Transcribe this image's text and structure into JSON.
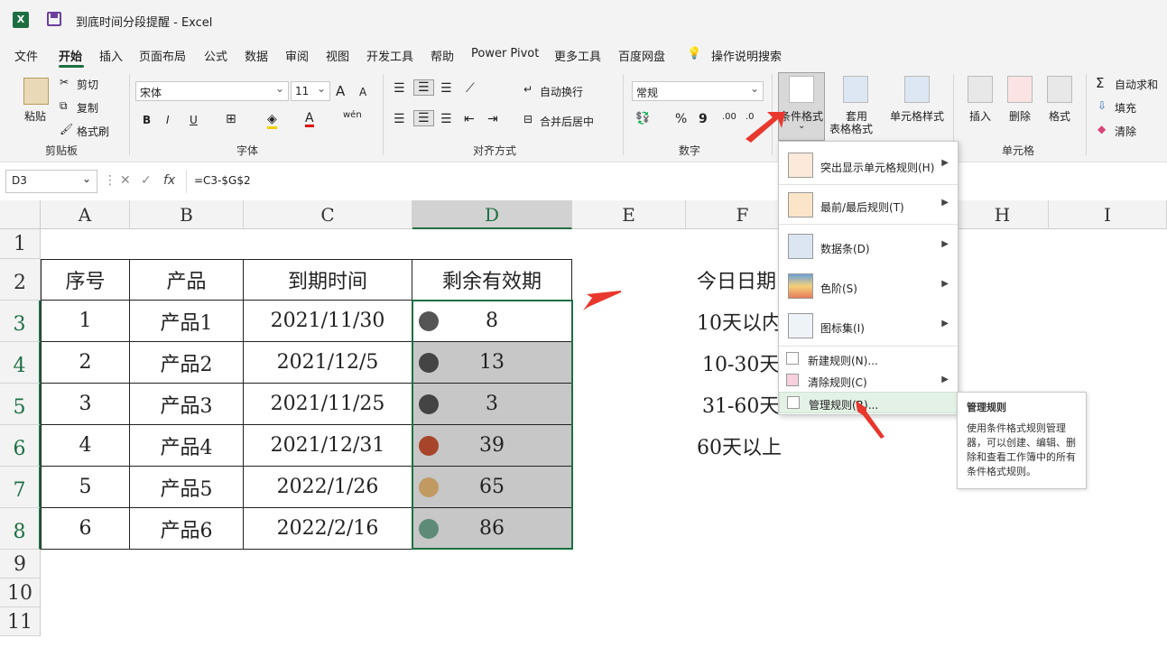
{
  "window": {
    "title": "到底时间分段提醒 - Excel",
    "app_icon": "X"
  },
  "menu": {
    "items": [
      "文件",
      "开始",
      "插入",
      "页面布局",
      "公式",
      "数据",
      "审阅",
      "视图",
      "开发工具",
      "帮助",
      "Power Pivot",
      "更多工具",
      "百度网盘"
    ],
    "active": "开始",
    "search_label": "操作说明搜索"
  },
  "ribbon": {
    "clipboard": {
      "paste": "粘贴",
      "cut": "剪切",
      "copy": "复制",
      "format_painter": "格式刷",
      "group": "剪贴板"
    },
    "font": {
      "name": "宋体",
      "size": "11",
      "bold": "B",
      "italic": "I",
      "underline": "U",
      "group": "字体",
      "grow": "A",
      "shrink": "A",
      "color_a": "A",
      "wen": "wén"
    },
    "alignment": {
      "wrap": "自动换行",
      "merge": "合并后居中",
      "group": "对齐方式"
    },
    "number": {
      "format": "常规",
      "percent": "%",
      "comma": "9",
      "group": "数字"
    },
    "styles": {
      "conditional": "条件格式",
      "table1": "套用",
      "table2": "表格格式",
      "cell_style": "单元格样式"
    },
    "cells": {
      "insert": "插入",
      "delete": "删除",
      "format": "格式",
      "group": "单元格"
    },
    "editing": {
      "autosum": "自动求和",
      "fill": "填充",
      "clear": "清除"
    }
  },
  "formula_bar": {
    "name_box": "D3",
    "formula": "=C3-$G$2",
    "fx": "fx"
  },
  "columns": [
    "A",
    "B",
    "C",
    "D",
    "E",
    "F",
    "",
    "H",
    "I"
  ],
  "rows": [
    "1",
    "2",
    "3",
    "4",
    "5",
    "6",
    "7",
    "8",
    "9",
    "10",
    "11"
  ],
  "table": {
    "headers": [
      "序号",
      "产品",
      "到期时间",
      "剩余有效期"
    ],
    "rows": [
      {
        "no": "1",
        "product": "产品1",
        "date": "2021/11/30",
        "remain": "8"
      },
      {
        "no": "2",
        "product": "产品2",
        "date": "2021/12/5",
        "remain": "13"
      },
      {
        "no": "3",
        "product": "产品3",
        "date": "2021/11/25",
        "remain": "3"
      },
      {
        "no": "4",
        "product": "产品4",
        "date": "2021/12/31",
        "remain": "39"
      },
      {
        "no": "5",
        "product": "产品5",
        "date": "2022/1/26",
        "remain": "65"
      },
      {
        "no": "6",
        "product": "产品6",
        "date": "2022/2/16",
        "remain": "86"
      }
    ],
    "dot_colors": [
      "#555555",
      "#444444",
      "#444444",
      "#a8442a",
      "#c19a62",
      "#5e8b78"
    ]
  },
  "f_column": [
    "今日日期",
    "10天以内",
    "10-30天",
    "31-60天",
    "60天以上"
  ],
  "dropdown": {
    "items": [
      "突出显示单元格规则(H)",
      "最前/最后规则(T)",
      "数据条(D)",
      "色阶(S)",
      "图标集(I)"
    ],
    "small_items": [
      "新建规则(N)...",
      "清除规则(C)",
      "管理规则(R)..."
    ]
  },
  "tooltip": {
    "title": "管理规则",
    "body": "使用条件格式规则管理器，可以创建、编辑、删除和查看工作簿中的所有条件格式规则。"
  },
  "colors": {
    "accent": "#1d6f42",
    "arrow": "#e8372d",
    "selected_fill": "#c7c7c7"
  }
}
